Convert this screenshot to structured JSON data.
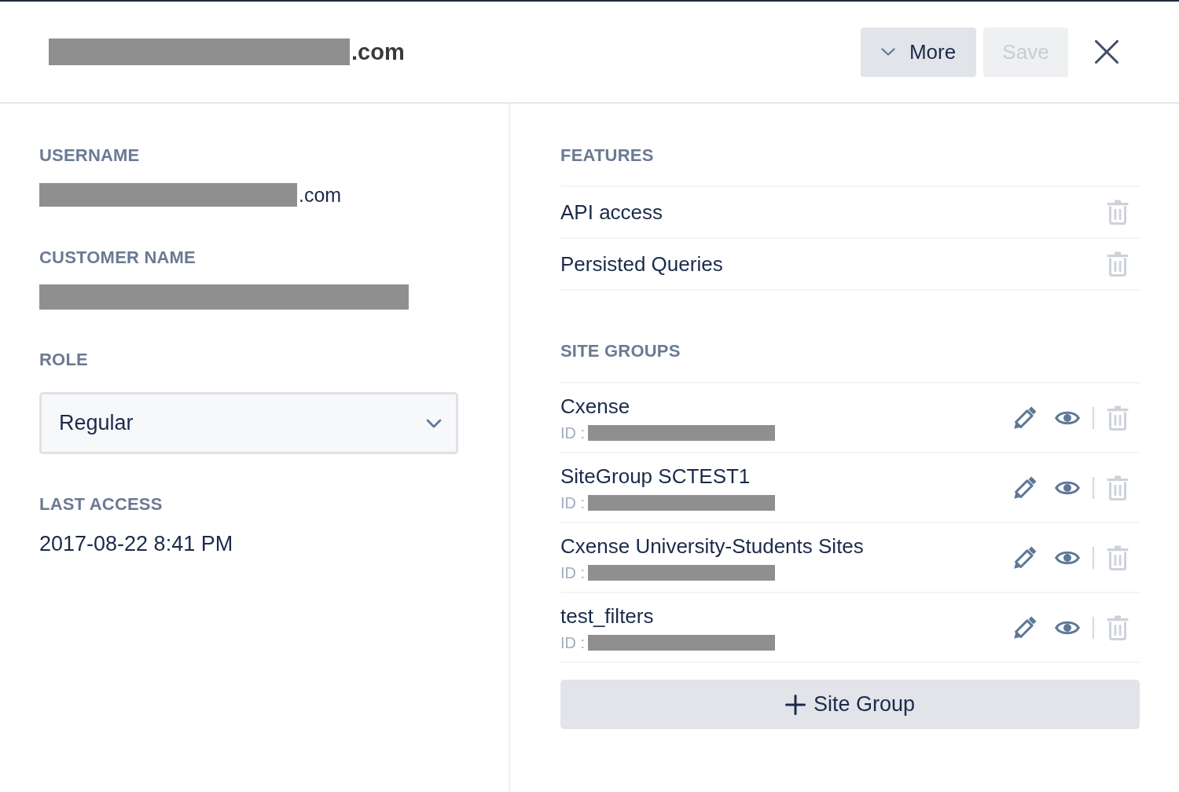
{
  "header": {
    "title": {
      "redacted": true,
      "text": ".com"
    },
    "buttons": [
      {
        "label": "More",
        "kind": "menu",
        "disabled": false
      },
      {
        "label": "Save",
        "kind": "submit",
        "disabled": true
      }
    ]
  },
  "fields": [
    {
      "label": "USERNAME",
      "kind": "text",
      "redacted": true,
      "value": ".com"
    },
    {
      "label": "CUSTOMER NAME",
      "kind": "text",
      "redacted": true
    },
    {
      "label": "ROLE",
      "kind": "select",
      "value": "Regular"
    },
    {
      "label": "LAST ACCESS",
      "kind": "text",
      "value": "2017-08-22 8:41 PM"
    }
  ],
  "features": {
    "heading": "FEATURES",
    "items": [
      {
        "name": "API access"
      },
      {
        "name": "Persisted Queries"
      }
    ]
  },
  "site_groups": {
    "heading": "SITE GROUPS",
    "items": [
      {
        "name": "Cxense",
        "id_label": "ID :",
        "id_redacted": true
      },
      {
        "name": "SiteGroup SCTEST1",
        "id_label": "ID :",
        "id_redacted": true
      },
      {
        "name": "Cxense University-Students Sites",
        "id_label": "ID :",
        "id_redacted": true
      },
      {
        "name": "test_filters",
        "id_label": "ID :",
        "id_redacted": true
      }
    ],
    "add_button": "Site Group"
  }
}
